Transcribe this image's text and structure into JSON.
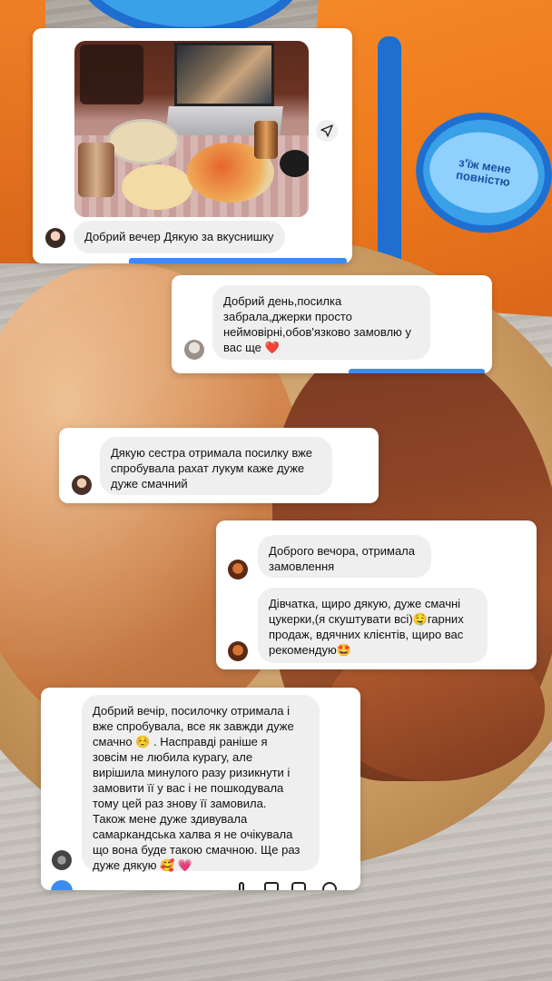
{
  "background": {
    "bag_badge_text": "з'їж мене повністю"
  },
  "messages": [
    {
      "id": "card1",
      "has_photo": true,
      "text": "Добрий вечер Дякую за вкуснишку"
    },
    {
      "id": "card2",
      "text": "Добрий день,посилка\nзабрала,джерки просто\nнеймовірні,обов'язково замовлю у\nвас ще ❤️"
    },
    {
      "id": "card3",
      "text": "Дякую сестра отримала посилку вже\nспробувала рахат лукум каже дуже\nдуже смачний"
    },
    {
      "id": "card4",
      "texts": [
        "Доброго вечора, отримала\nзамовлення",
        "Дівчатка, щиро дякую, дуже смачні\nцукерки,(я скуштувати всі)🤤гарних\nпродаж, вдячних клієнтів, щиро вас\nрекомендую🤩"
      ]
    },
    {
      "id": "card5",
      "text": "Добрий вечір, посилочку отримала і\nвже спробувала, все як завжди дуже\nсмачно ☺️ . Насправді раніше я\nзовсім не любила курагу, але\nвирішила минулого разу ризикнути і\nзамовити її у вас і не пошкодувала\nтому цей раз знову її замовила.\nТакож мене дуже здивувала\nсамаркандська халва я не очікувала\nщо вона буде такою смачною. Ще раз\nдуже дякую 🥰 💗"
    }
  ],
  "colors": {
    "bubble_bg": "#efefef",
    "accent_blue": "#3b8cf0",
    "bag_orange": "#ee7b1c"
  }
}
